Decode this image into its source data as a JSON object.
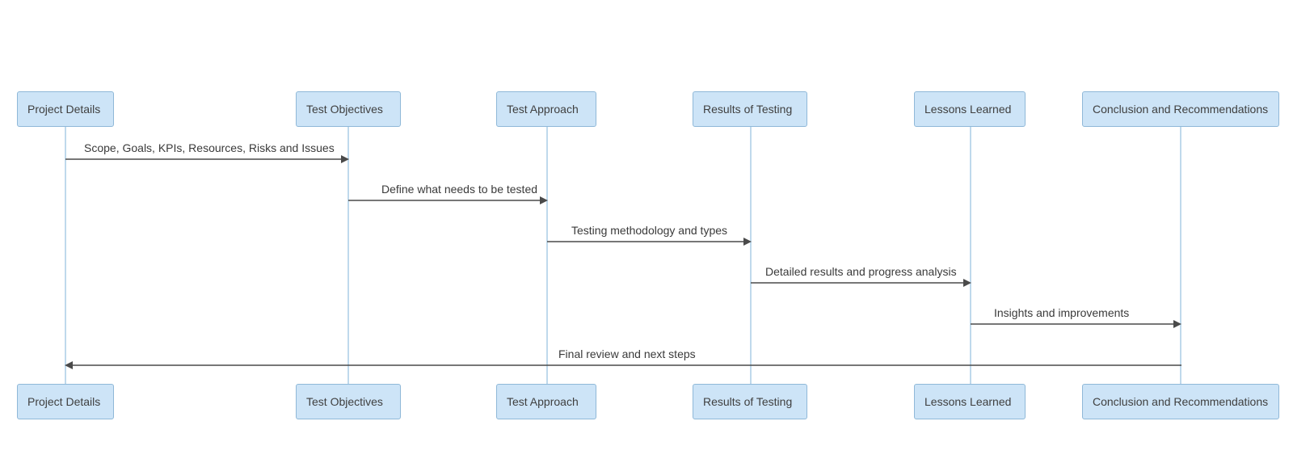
{
  "diagram": {
    "type": "sequence",
    "participants": [
      {
        "id": "project_details",
        "label": "Project Details"
      },
      {
        "id": "test_objectives",
        "label": "Test Objectives"
      },
      {
        "id": "test_approach",
        "label": "Test Approach"
      },
      {
        "id": "results_of_testing",
        "label": "Results of Testing"
      },
      {
        "id": "lessons_learned",
        "label": "Lessons Learned"
      },
      {
        "id": "conclusion_recs",
        "label": "Conclusion and Recommendations"
      }
    ],
    "messages": [
      {
        "from": "project_details",
        "to": "test_objectives",
        "label": "Scope, Goals, KPIs, Resources, Risks and Issues"
      },
      {
        "from": "test_objectives",
        "to": "test_approach",
        "label": "Define what needs to be tested"
      },
      {
        "from": "test_approach",
        "to": "results_of_testing",
        "label": "Testing methodology and types"
      },
      {
        "from": "results_of_testing",
        "to": "lessons_learned",
        "label": "Detailed results and progress analysis"
      },
      {
        "from": "lessons_learned",
        "to": "conclusion_recs",
        "label": "Insights and improvements"
      },
      {
        "from": "conclusion_recs",
        "to": "project_details",
        "label": "Final review and next steps"
      }
    ],
    "colors": {
      "participant_fill": "#cde4f7",
      "participant_border": "#8fb8d8",
      "lifeline": "#bfd9ec",
      "arrow": "#4a4a4a",
      "text": "#3a3a3a"
    }
  }
}
